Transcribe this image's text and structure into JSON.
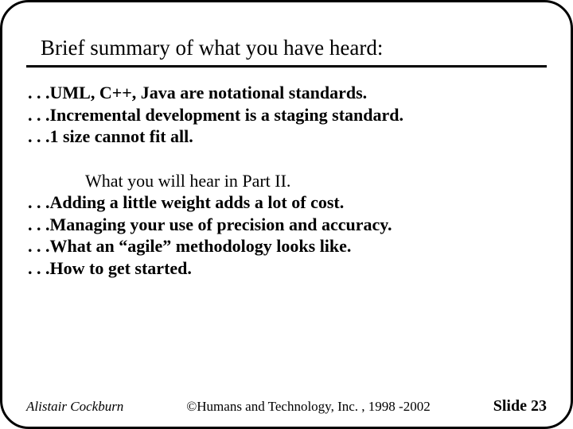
{
  "title": "Brief summary of what you have heard:",
  "summary_items": [
    ". . .UML, C++, Java are notational standards.",
    ". . .Incremental development is a staging standard.",
    ". . .1 size cannot fit all."
  ],
  "part2_heading": "What you will hear in Part II.",
  "part2_items": [
    ". . .Adding a little weight adds a lot of cost.",
    ". . .Managing your use of precision and accuracy.",
    ". . .What an “agile” methodology looks like.",
    ". . .How to get started."
  ],
  "footer": {
    "author": "Alistair Cockburn",
    "copyright": "©Humans and Technology, Inc. , 1998 -2002",
    "slide": "Slide 23"
  }
}
